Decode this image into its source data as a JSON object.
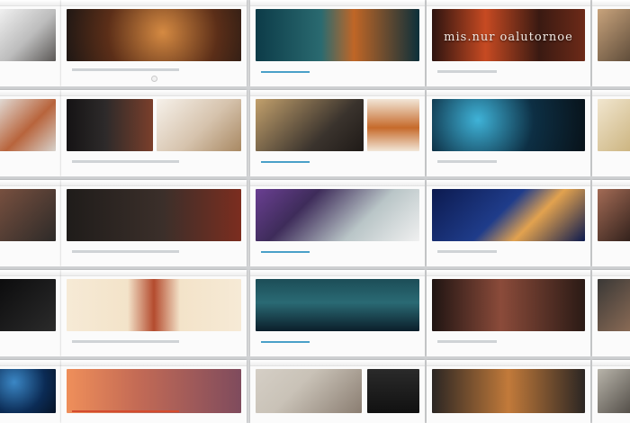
{
  "screenshots": [
    {
      "id": "r1c0",
      "title": "",
      "colors": [
        "#f1f1f1",
        "#6e6a66"
      ]
    },
    {
      "id": "r1c1",
      "title": "",
      "colors": [
        "#2a1f1a",
        "#c77536"
      ]
    },
    {
      "id": "r1c2",
      "title": "",
      "colors": [
        "#0d3f4d",
        "#c06626"
      ]
    },
    {
      "id": "r1c3",
      "title": "mis.nur oalutornoe",
      "colors": [
        "#3a1a12",
        "#cc4a22"
      ]
    },
    {
      "id": "r1c4",
      "title": "",
      "colors": [
        "#b0906c",
        "#5c4a38"
      ]
    },
    {
      "id": "r2c0",
      "title": "",
      "colors": [
        "#e8e6e3",
        "#b4623a"
      ]
    },
    {
      "id": "r2c1",
      "title": "",
      "colors": [
        "#1d1b1c",
        "#7b3f2b"
      ]
    },
    {
      "id": "r2c2",
      "title": "",
      "colors": [
        "#bfa26f",
        "#3a332d"
      ]
    },
    {
      "id": "r2c3",
      "title": "",
      "colors": [
        "#0a1620",
        "#1a86b3"
      ]
    },
    {
      "id": "r2c4",
      "title": "",
      "colors": [
        "#efe5cf",
        "#cbb37e"
      ]
    },
    {
      "id": "r3c0",
      "title": "",
      "colors": [
        "#6d4a3a",
        "#2d2a28"
      ]
    },
    {
      "id": "r3c1",
      "title": "",
      "colors": [
        "#2a2622",
        "#7c2d1f"
      ]
    },
    {
      "id": "r3c2",
      "title": "",
      "colors": [
        "#3e2c5a",
        "#b9c5c7"
      ]
    },
    {
      "id": "r3c3",
      "title": "",
      "colors": [
        "#0f1f5c",
        "#e2a24f"
      ]
    },
    {
      "id": "r3c4",
      "title": "",
      "colors": [
        "#8a5d4a",
        "#2f1f1a"
      ]
    },
    {
      "id": "r4c0",
      "title": "",
      "colors": [
        "#0f0f10",
        "#2b2b2b"
      ]
    },
    {
      "id": "r4c1",
      "title": "",
      "colors": [
        "#f3e3c9",
        "#b44b2e"
      ]
    },
    {
      "id": "r4c2",
      "title": "",
      "colors": [
        "#1c4d57",
        "#0b1e2a"
      ]
    },
    {
      "id": "r4c3",
      "title": "",
      "colors": [
        "#2a1a15",
        "#8b4b3a"
      ]
    },
    {
      "id": "r4c4",
      "title": "",
      "colors": [
        "#3a3836",
        "#8c6c56"
      ]
    },
    {
      "id": "r5c0",
      "title": "",
      "colors": [
        "#0b2b55",
        "#3b87c5"
      ]
    },
    {
      "id": "r5c1",
      "title": "",
      "colors": [
        "#ef8f5a",
        "#7f4b5d"
      ]
    },
    {
      "id": "r5c2",
      "title": "",
      "colors": [
        "#c9c2b7",
        "#2a2a2a"
      ]
    },
    {
      "id": "r5c3",
      "title": "",
      "colors": [
        "#2b2623",
        "#c27a3a"
      ]
    },
    {
      "id": "r5c4",
      "title": "",
      "colors": [
        "#b8b4aa",
        "#504b45"
      ]
    }
  ]
}
